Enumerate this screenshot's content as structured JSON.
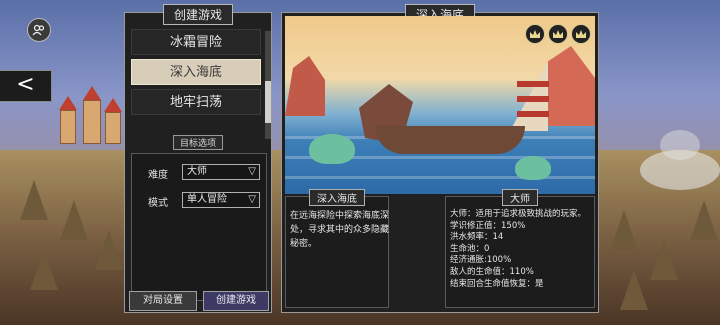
{
  "left_panel": {
    "title": "创建游戏",
    "modes": [
      "冰霜冒险",
      "深入海底",
      "地牢扫荡"
    ],
    "selected_mode_index": 1,
    "section_label": "目标选项",
    "options": [
      {
        "label": "难度",
        "value": "大师"
      },
      {
        "label": "模式",
        "value": "单人冒险"
      }
    ],
    "buttons": {
      "settings": "对局设置",
      "create": "创建游戏"
    }
  },
  "right_panel": {
    "title": "深入海底",
    "description_title": "深入海底",
    "description": "在远海探险中探索海底深处，寻求其中的众多隐藏秘密。",
    "difficulty_title": "大师",
    "difficulty_lines": [
      "大师：适用于追求极致挑战的玩家。",
      "学识修正值：150%",
      "洪水频率：14",
      "生命池：0",
      "经济通胀:100%",
      "敌人的生命值：110%",
      "结束回合生命值恢复：是"
    ]
  },
  "nav": {
    "back": "<"
  },
  "colors": {
    "accent": "#3e3a66",
    "selected_item": "#d8cdb8",
    "panel_bg": "#202020"
  }
}
